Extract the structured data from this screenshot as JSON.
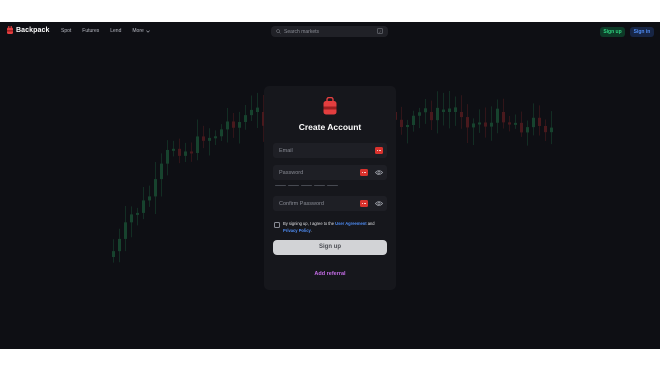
{
  "nav": {
    "brand": "Backpack",
    "links": [
      {
        "label": "Spot"
      },
      {
        "label": "Futures"
      },
      {
        "label": "Lend"
      },
      {
        "label": "More"
      }
    ],
    "search_placeholder": "Search markets",
    "search_shortcut": "/",
    "signup_label": "Sign up",
    "signin_label": "Sign in"
  },
  "form": {
    "title": "Create Account",
    "email_placeholder": "Email",
    "password_placeholder": "Password",
    "confirm_placeholder": "Confirm Password",
    "terms_prefix": "By signing up, I agree to the ",
    "terms_link": "User Agreement",
    "terms_and": " and ",
    "privacy_link": "Privacy Policy",
    "terms_suffix": ".",
    "submit_label": "Sign up",
    "referral_label": "Add referral"
  },
  "colors": {
    "background": "#0e0f14",
    "card": "#16171c",
    "brand_red": "#e33e3f",
    "signup_green": "#2ed37f",
    "signin_blue": "#4f8df5",
    "referral_purple": "#c46ce6"
  },
  "icons": {
    "brand": "backpack-logo-icon",
    "search": "search-icon",
    "more": "chevron-down-icon",
    "form": "lock-icon",
    "password_manager": "password-manager-icon",
    "reveal": "eye-icon"
  }
}
